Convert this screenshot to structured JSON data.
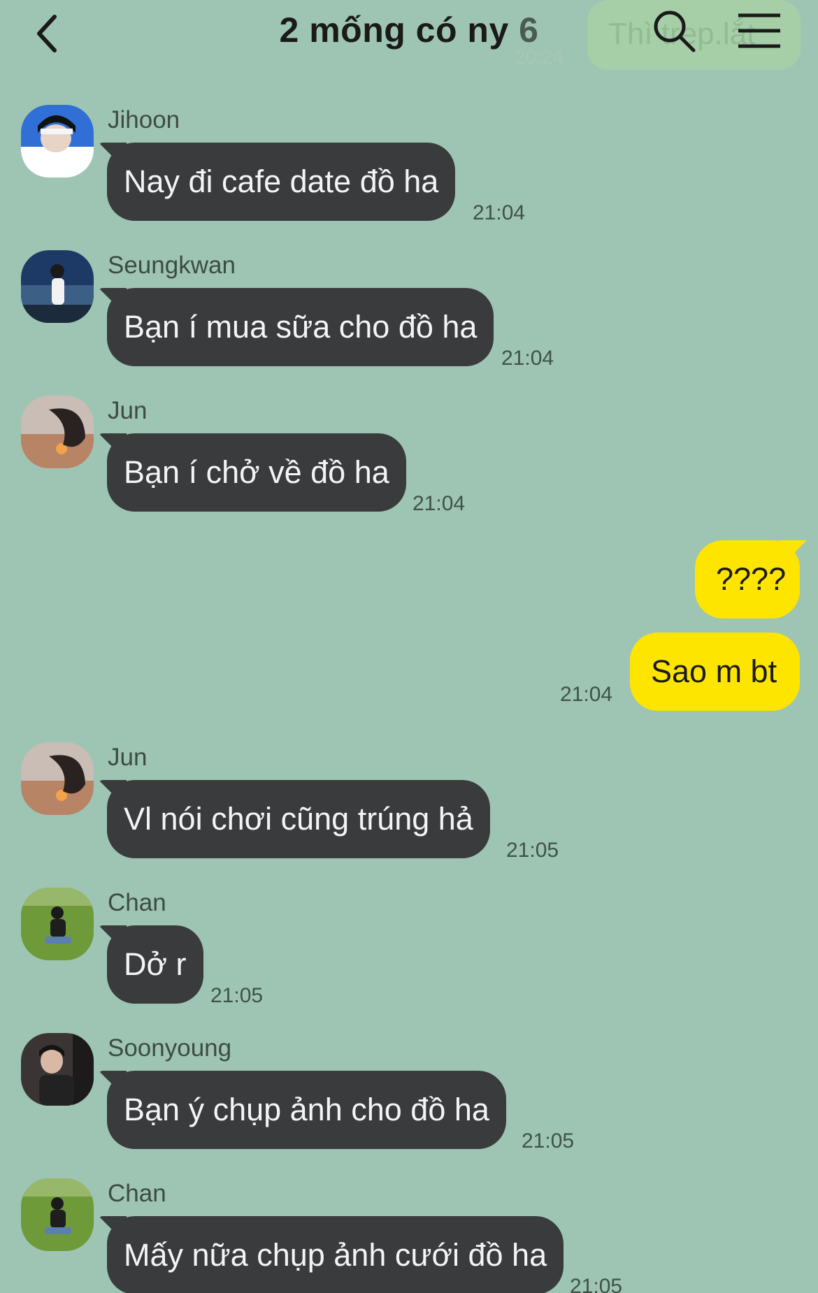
{
  "header": {
    "title": "2 mống có ny",
    "member_count": "6",
    "ghost_preview_text": "Thì trep.lắt",
    "ghost_preview_time": "20:24"
  },
  "messages": [
    {
      "sender": "Jihoon",
      "text": "Nay đi cafe date đồ ha",
      "time": "21:04"
    },
    {
      "sender": "Seungkwan",
      "text": "Bạn í mua sữa cho đồ ha",
      "time": "21:04"
    },
    {
      "sender": "Jun",
      "text": "Bạn í chở về đồ ha",
      "time": "21:04"
    },
    {
      "text": "????"
    },
    {
      "text": "Sao m bt",
      "time": "21:04"
    },
    {
      "sender": "Jun",
      "text": "Vl nói chơi cũng trúng hả",
      "time": "21:05"
    },
    {
      "sender": "Chan",
      "text": "Dở r",
      "time": "21:05"
    },
    {
      "sender": "Soonyoung",
      "text": "Bạn ý chụp ảnh cho đồ ha",
      "time": "21:05"
    },
    {
      "sender": "Chan",
      "text": "Mấy nữa chụp ảnh cưới đồ ha",
      "time": "21:05"
    }
  ],
  "icons": {
    "back": "chevron-left-icon",
    "search": "search-icon",
    "menu": "hamburger-menu-icon"
  },
  "colors": {
    "background": "#9ec5b3",
    "incoming_bubble": "#3a3b3d",
    "outgoing_bubble": "#fee500"
  }
}
